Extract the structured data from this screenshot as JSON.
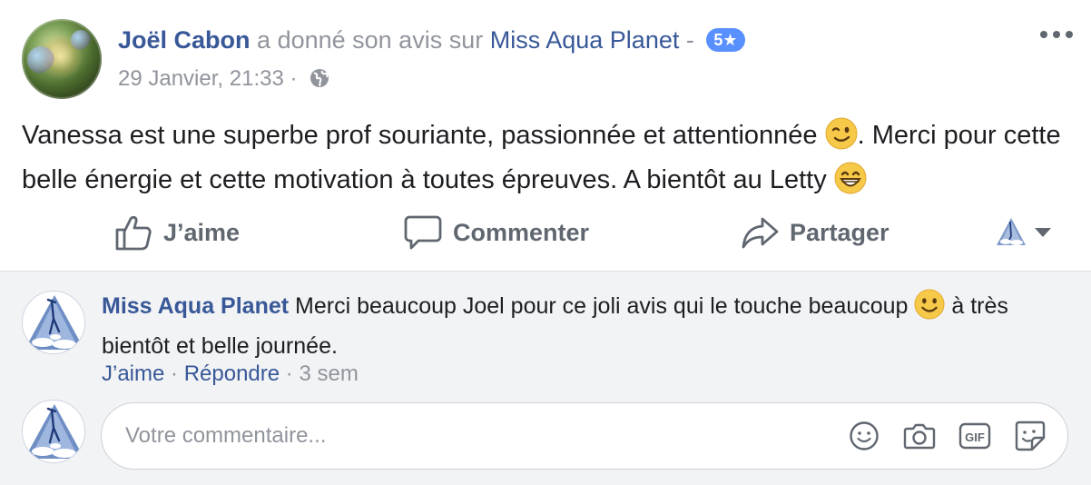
{
  "post": {
    "author": "Joël Cabon",
    "action_text": "a donné son avis sur",
    "page_name": "Miss Aqua Planet",
    "separator": "-",
    "rating": "5★",
    "timestamp": "29 Janvier, 21:33",
    "meta_separator": "·",
    "privacy_icon": "globe-icon",
    "more_icon": "more-options-icon",
    "body_part1": "Vanessa est une superbe prof souriante, passionnée et attentionnée",
    "body_part2": ". Merci pour cette belle énergie et cette motivation à toutes épreuves. A bientôt au Letty",
    "emoji1": "winking-face-emoji",
    "emoji2": "grinning-face-emoji"
  },
  "actions": {
    "like": "J’aime",
    "comment": "Commenter",
    "share": "Partager",
    "reaction_icon": "page-avatar-reaction-selector"
  },
  "comment": {
    "author": "Miss Aqua Planet",
    "text_part1": "Merci beaucoup Joel pour ce joli avis qui le touche beaucoup",
    "text_part2": "à très bientôt et belle journée.",
    "emoji": "smiling-face-emoji",
    "like": "J’aime",
    "reply": "Répondre",
    "separator": "·",
    "time": "3 sem"
  },
  "composer": {
    "placeholder": "Votre commentaire...",
    "icons": [
      "emoji-icon",
      "camera-icon",
      "gif-icon",
      "sticker-icon"
    ]
  },
  "colors": {
    "link_blue": "#385898",
    "meta_gray": "#90949c",
    "badge_blue": "#5890ff",
    "comment_bg": "#f2f3f5"
  }
}
